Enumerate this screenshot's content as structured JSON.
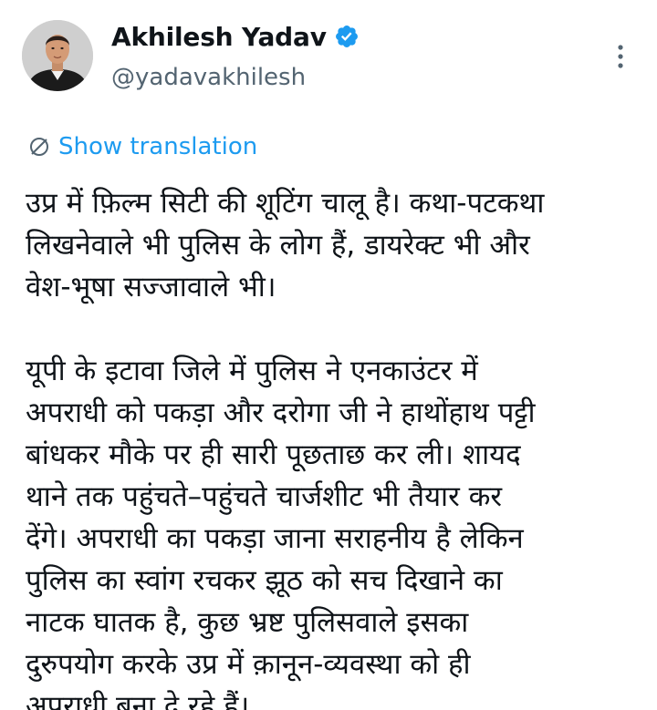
{
  "author": {
    "display_name": "Akhilesh Yadav",
    "handle": "@yadavakhilesh",
    "verified": true,
    "avatar_icon": "profile-photo",
    "verified_icon": "verified-badge-icon"
  },
  "actions": {
    "more_icon": "more-vertical-icon",
    "translate_icon": "globe-icon",
    "translate_label": "Show translation"
  },
  "tweet": {
    "paragraphs": [
      "उप्र में फ़िल्म सिटी की शूटिंग चालू है। कथा-पटकथा\nलिखनेवाले भी पुलिस के लोग हैं, डायरेक्ट भी और\nवेश-भूषा सज्जावाले भी।",
      "यूपी के इटावा जिले में पुलिस ने एनकाउंटर में\nअपराधी को पकड़ा और दरोगा जी ने हाथोंहाथ पट्टी\nबांधकर मौके पर ही सारी पूछताछ कर ली। शायद\nथाने तक पहुंचते–पहुंचते चार्जशीट भी तैयार कर\nदेंगे। अपराधी का पकड़ा जाना सराहनीय है लेकिन\nपुलिस का स्वांग रचकर झूठ को सच दिखाने का\nनाटक घातक है, कुछ भ्रष्ट पुलिसवाले इसका\nदुरुपयोग करके उप्र में क़ानून-व्यवस्था को ही\nअपराधी बना दे रहे हैं।"
    ]
  },
  "colors": {
    "link": "#1d9bf0",
    "secondary_text": "#536471",
    "primary_text": "#0f1419",
    "background": "#ffffff"
  }
}
